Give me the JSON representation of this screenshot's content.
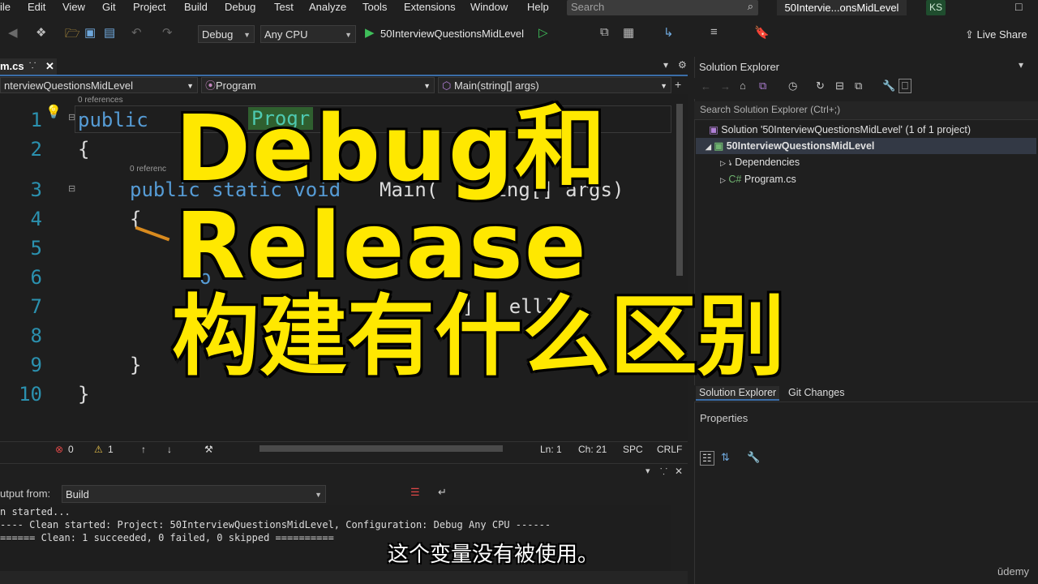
{
  "menu": [
    "ile",
    "Edit",
    "View",
    "Git",
    "Project",
    "Build",
    "Debug",
    "Test",
    "Analyze",
    "Tools",
    "Extensions",
    "Window",
    "Help"
  ],
  "search": {
    "placeholder": "Search"
  },
  "title_project": "50Intervie...onsMidLevel",
  "user_initials": "KS",
  "toolbar": {
    "config": "Debug",
    "platform": "Any CPU",
    "run_target": "50InterviewQuestionsMidLevel",
    "live_share": "Live Share"
  },
  "editor": {
    "tab_label": "m.cs",
    "nav_project": "nterviewQuestionsMidLevel",
    "nav_class": "Program",
    "nav_member": "Main(string[] args)",
    "refs_0": "0 references",
    "refs_1": "0 referenc",
    "line_numbers": [
      "1",
      "2",
      "3",
      "4",
      "5",
      "6",
      "7",
      "8",
      "9",
      "10"
    ],
    "line1_kw": "public",
    "line1_type": "Progr",
    "line2": "{",
    "line3_kw": "public static void",
    "line3_rest": "Main(",
    "line3_tail": "ring[] args)",
    "line4": "{",
    "line6": "o",
    "line7": "] + ell]",
    "line9": "}",
    "line10": "}"
  },
  "status": {
    "errors": "0",
    "warnings": "1",
    "ln": "Ln: 1",
    "ch": "Ch: 21",
    "spc": "SPC",
    "crlf": "CRLF"
  },
  "output": {
    "label": "utput from:",
    "source": "Build",
    "lines": [
      "n started...",
      "---- Clean started: Project: 50InterviewQuestionsMidLevel, Configuration: Debug Any CPU ------",
      "====== Clean: 1 succeeded, 0 failed, 0 skipped =========="
    ]
  },
  "solution_explorer": {
    "title": "Solution Explorer",
    "search_placeholder": "Search Solution Explorer (Ctrl+;)",
    "solution": "Solution '50InterviewQuestionsMidLevel' (1 of 1 project)",
    "project": "50InterviewQuestionsMidLevel",
    "dependencies": "Dependencies",
    "program": "Program.cs",
    "tab_se": "Solution Explorer",
    "tab_git": "Git Changes"
  },
  "properties": {
    "title": "Properties"
  },
  "overlay": {
    "line1": "Debug和",
    "line2": "Release",
    "line3": "构建有什么区别",
    "subtitle": "这个变量没有被使用。",
    "watermark": "ūdemy"
  },
  "colors": {
    "accent": "#3b6ea8",
    "keyword": "#569cd6",
    "type": "#4ec9b0",
    "overlay_yellow": "#ffe800",
    "line_number": "#2b91af"
  }
}
